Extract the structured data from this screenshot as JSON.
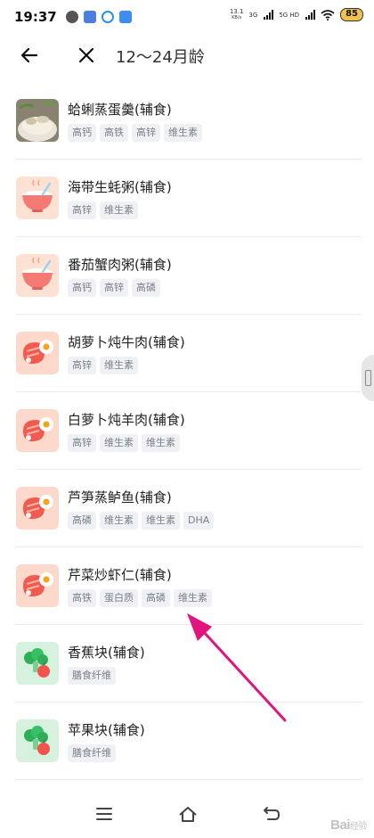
{
  "status_bar": {
    "time": "19:37",
    "net_speed_value": "13.1",
    "net_speed_unit": "KB/s",
    "signal1_label": "3G",
    "signal2_label": "5G HD",
    "battery": "85"
  },
  "header": {
    "title": "12～24月龄"
  },
  "foods": [
    {
      "name": "蛤蜊蒸蛋羹(辅食)",
      "icon": "clam-egg-photo",
      "tags": [
        "高钙",
        "高铁",
        "高锌",
        "维生素"
      ]
    },
    {
      "name": "海带生蚝粥(辅食)",
      "icon": "porridge-bowl-icon",
      "tags": [
        "高锌",
        "维生素"
      ]
    },
    {
      "name": "番茄蟹肉粥(辅食)",
      "icon": "porridge-bowl-icon",
      "tags": [
        "高钙",
        "高锌",
        "高磷"
      ]
    },
    {
      "name": "胡萝卜炖牛肉(辅食)",
      "icon": "meat-egg-icon",
      "tags": [
        "高锌",
        "维生素"
      ]
    },
    {
      "name": "白萝卜炖羊肉(辅食)",
      "icon": "meat-egg-icon",
      "tags": [
        "高锌",
        "维生素",
        "维生素"
      ]
    },
    {
      "name": "芦笋蒸鲈鱼(辅食)",
      "icon": "meat-egg-icon",
      "tags": [
        "高磷",
        "维生素",
        "维生素",
        "DHA"
      ]
    },
    {
      "name": "芹菜炒虾仁(辅食)",
      "icon": "meat-egg-icon",
      "tags": [
        "高铁",
        "蛋白质",
        "高磷",
        "维生素"
      ]
    },
    {
      "name": "香蕉块(辅食)",
      "icon": "vegetable-icon",
      "tags": [
        "膳食纤维"
      ]
    },
    {
      "name": "苹果块(辅食)",
      "icon": "vegetable-icon",
      "tags": [
        "膳食纤维"
      ]
    }
  ],
  "watermark": {
    "main": "Bai",
    "sub": "经验"
  },
  "colors": {
    "annotation_arrow": "#e0157e",
    "tag_bg": "#eff1f4",
    "tag_text": "#7a7f8a",
    "battery_bg": "#f2c14a"
  }
}
